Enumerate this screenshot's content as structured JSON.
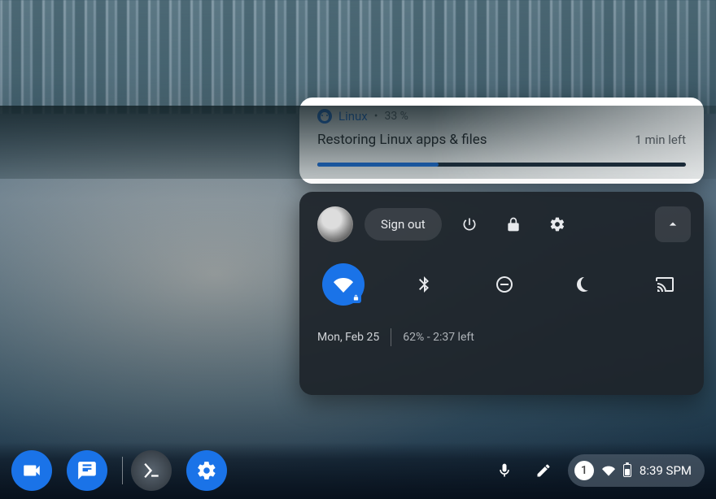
{
  "notification": {
    "app_name": "Linux",
    "separator": "•",
    "percent_text": "33 %",
    "percent_value": 33,
    "title": "Restoring Linux apps & files",
    "eta": "1 min left"
  },
  "panel": {
    "sign_out_label": "Sign out",
    "date": "Mon, Feb 25",
    "battery_text": "62% - 2:37 left"
  },
  "status": {
    "notification_count": "1",
    "time": "8:39 SPM"
  }
}
